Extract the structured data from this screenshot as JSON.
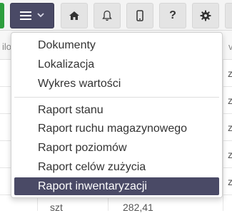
{
  "table": {
    "header_left": "ilo",
    "header_right": "v",
    "unit": "szt",
    "value": "282,41",
    "right_col": [
      "z",
      "z",
      "z",
      "z",
      "z"
    ]
  },
  "menu": {
    "items_group1": [
      "Dokumenty",
      "Lokalizacja",
      "Wykres wartości"
    ],
    "items_group2": [
      "Raport stanu",
      "Raport ruchu magazynowego",
      "Raport poziomów",
      "Raport celów zużycia",
      "Raport inwentaryzacji"
    ],
    "active_item": "Raport inwentaryzacji"
  },
  "toolbar": {
    "help_glyph": "?"
  },
  "colors": {
    "accent": "#4a4a66",
    "green": "#2e9e3e"
  },
  "icons": [
    "menu-icon",
    "chevron-down-icon",
    "home-icon",
    "bell-icon",
    "phone-icon",
    "help-icon",
    "gear-icon"
  ]
}
